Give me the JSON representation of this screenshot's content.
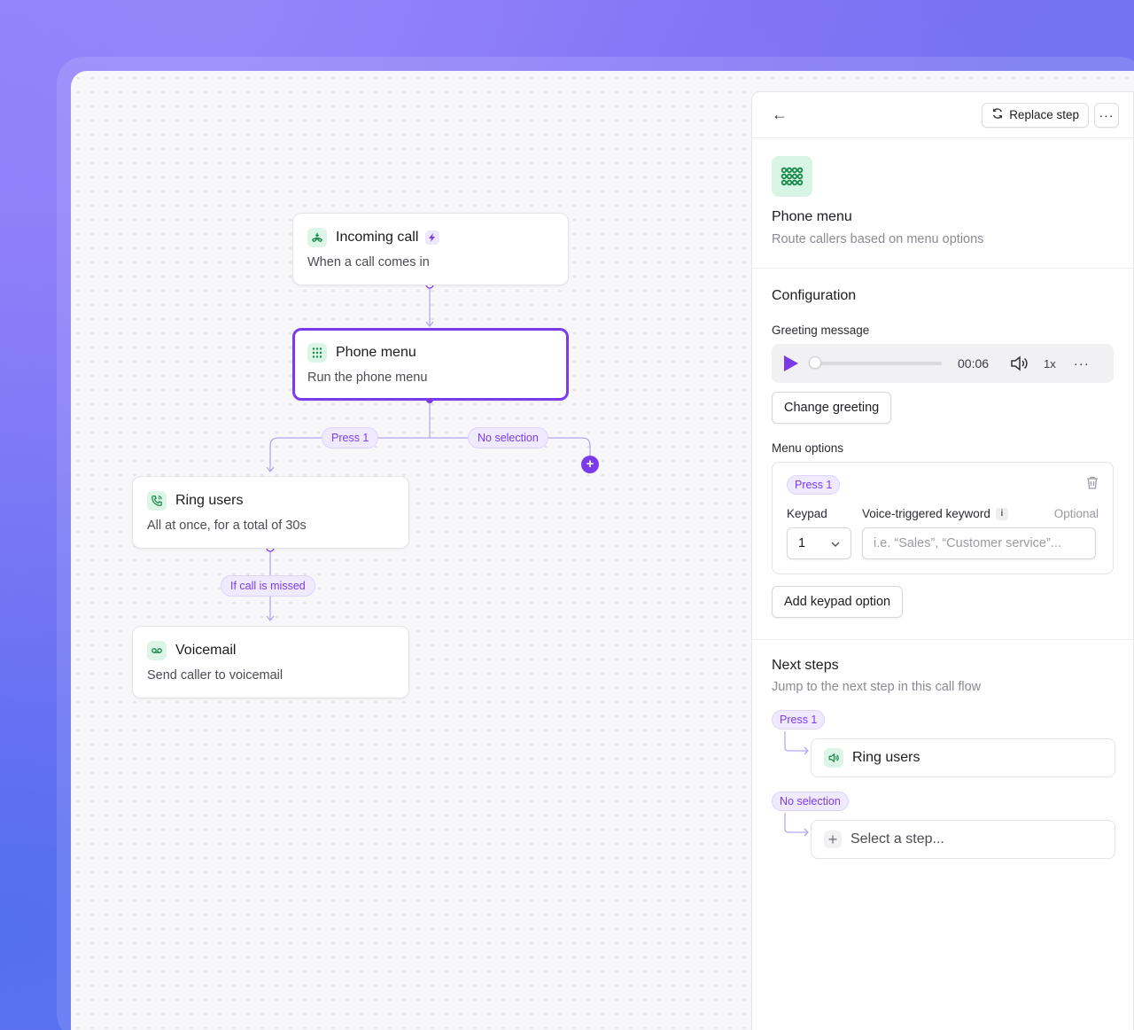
{
  "canvas": {
    "nodes": {
      "incoming_call": {
        "title": "Incoming call",
        "desc": "When a call comes in",
        "icon": "phone-incoming-icon"
      },
      "phone_menu": {
        "title": "Phone menu",
        "desc": "Run the phone menu",
        "icon": "keypad-icon"
      },
      "ring_users": {
        "title": "Ring users",
        "desc": "All at once, for a total of 30s",
        "icon": "phone-ring-icon"
      },
      "voicemail": {
        "title": "Voicemail",
        "desc": "Send caller to voicemail",
        "icon": "voicemail-icon"
      }
    },
    "edge_labels": {
      "press_1": "Press 1",
      "no_selection": "No selection",
      "if_missed": "If call is missed"
    },
    "add_symbol": "+"
  },
  "panel": {
    "back_icon": "←",
    "replace_step_label": "Replace step",
    "more_label": "···",
    "hero": {
      "title": "Phone menu",
      "subtitle": "Route callers based on menu options"
    },
    "configuration": {
      "title": "Configuration",
      "greeting_label": "Greeting message",
      "audio": {
        "time": "00:06",
        "speed": "1x",
        "progress": 0.0,
        "more": "···"
      },
      "change_greeting_label": "Change greeting",
      "menu_options_label": "Menu options",
      "option": {
        "badge": "Press 1",
        "keypad_label": "Keypad",
        "keyword_label": "Voice-triggered keyword",
        "info": "i",
        "optional_label": "Optional",
        "keypad_value": "1",
        "keyword_placeholder": "i.e. “Sales”, “Customer service”..."
      },
      "add_option_label": "Add keypad option"
    },
    "next_steps": {
      "title": "Next steps",
      "subtitle": "Jump to the next step in this call flow",
      "items": [
        {
          "badge": "Press 1",
          "step": "Ring users"
        },
        {
          "badge": "No selection",
          "step": "Select a step...",
          "plus": "+"
        }
      ]
    }
  },
  "colors": {
    "accent": "#7c3aed",
    "icon_bg": "#dcf5e7",
    "icon_fg": "#17894a"
  }
}
